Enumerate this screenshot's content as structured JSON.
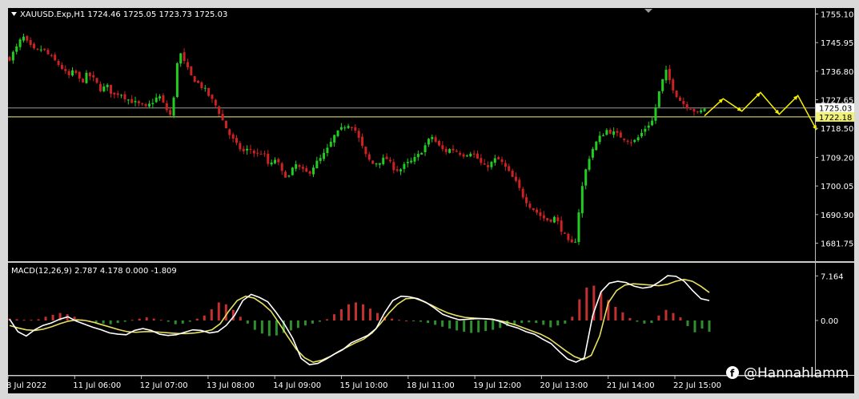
{
  "watermark": "@Hannahlamm",
  "colors": {
    "background": "#000000",
    "bull": "#22cc22",
    "bear": "#cc2222",
    "macd_line": "#ffffff",
    "signal_line": "#e8e060",
    "hist_pos": "#c43030",
    "hist_neg": "#2f8f2f",
    "hline_grey": "#9a9a9a",
    "hline_yellow": "#f2f27a",
    "arrow": "#f7f000"
  },
  "chart_data": [
    {
      "type": "candlestick",
      "header": "XAUUSD.Exp,H1  1724.46 1725.05 1723.73 1725.03",
      "ylim": [
        1677,
        1756
      ],
      "y_ticks": [
        "1755.10",
        "1745.95",
        "1736.80",
        "1727.65",
        "1718.50",
        "1709.20",
        "1700.05",
        "1690.90",
        "1681.75"
      ],
      "price_labels": [
        {
          "text": "1725.03",
          "value": 1725.03,
          "style": "grey"
        },
        {
          "text": "1722.18",
          "value": 1722.18,
          "style": "yellow"
        }
      ],
      "horizontal_lines": [
        {
          "value": 1725.03,
          "style": "grey"
        },
        {
          "value": 1722.18,
          "style": "yellow"
        }
      ],
      "x_ticks": [
        "8 Jul 2022",
        "11 Jul 06:00",
        "12 Jul 07:00",
        "13 Jul 08:00",
        "14 Jul 09:00",
        "15 Jul 10:00",
        "18 Jul 11:00",
        "19 Jul 12:00",
        "20 Jul 13:00",
        "21 Jul 14:00",
        "22 Jul 15:00"
      ],
      "close_path": [
        1741,
        1744,
        1748,
        1745,
        1743,
        1744,
        1742,
        1740,
        1738,
        1735,
        1737,
        1733,
        1736,
        1734,
        1731,
        1732,
        1729,
        1730,
        1728,
        1727,
        1726,
        1725,
        1727,
        1729,
        1725,
        1722,
        1744,
        1739,
        1735,
        1733,
        1731,
        1728,
        1725,
        1720,
        1716,
        1713,
        1711,
        1712,
        1710,
        1711,
        1706,
        1709,
        1704,
        1703,
        1707,
        1705,
        1704,
        1707,
        1709,
        1712,
        1716,
        1718,
        1720,
        1719,
        1714,
        1709,
        1707,
        1708,
        1709,
        1706,
        1705,
        1707,
        1708,
        1710,
        1713,
        1716,
        1713,
        1711,
        1712,
        1711,
        1710,
        1711,
        1709,
        1706,
        1707,
        1709,
        1707,
        1704,
        1701,
        1697,
        1694,
        1692,
        1690,
        1689,
        1690,
        1686,
        1682,
        1681,
        1698,
        1708,
        1713,
        1716,
        1718,
        1717,
        1716,
        1715,
        1714,
        1716,
        1719,
        1721,
        1730,
        1737,
        1732,
        1728,
        1726,
        1725,
        1723,
        1725.03
      ],
      "forecast_path": [
        1722.5,
        1728,
        1724,
        1730,
        1723,
        1729,
        1718
      ]
    },
    {
      "type": "macd",
      "header": "MACD(12,26,9) 2.787 4.178 0.000 -1.809",
      "ylim": [
        -8.5,
        8.5
      ],
      "y_ticks": [
        "7.164",
        "0.00"
      ],
      "macd": [
        0.2,
        -1.8,
        -2.5,
        -1.5,
        -0.8,
        -0.4,
        0.2,
        0.6,
        -0.1,
        -0.6,
        -1.1,
        -1.5,
        -2.0,
        -2.2,
        -2.3,
        -1.6,
        -1.3,
        -1.6,
        -2.2,
        -2.4,
        -2.3,
        -1.9,
        -1.5,
        -1.6,
        -2.0,
        -1.8,
        -0.8,
        0.8,
        3.2,
        4.2,
        3.7,
        3.0,
        1.3,
        -0.6,
        -2.9,
        -6.1,
        -7.1,
        -6.9,
        -6.2,
        -5.4,
        -4.7,
        -3.6,
        -3.0,
        -2.4,
        -1.3,
        1.2,
        3.2,
        3.9,
        3.8,
        3.5,
        2.9,
        2.0,
        1.0,
        0.5,
        0.1,
        0.2,
        0.3,
        0.3,
        0.2,
        -0.2,
        -0.8,
        -1.2,
        -1.8,
        -2.2,
        -3.0,
        -3.7,
        -5.0,
        -6.2,
        -6.7,
        -6.0,
        0.8,
        4.6,
        6.0,
        6.3,
        6.1,
        5.5,
        5.2,
        5.4,
        6.2,
        7.2,
        7.1,
        6.3,
        4.8,
        3.5,
        3.2
      ],
      "signal": [
        -0.8,
        -1.2,
        -1.5,
        -1.6,
        -1.4,
        -1.0,
        -0.5,
        -0.1,
        0.1,
        0.0,
        -0.3,
        -0.7,
        -1.1,
        -1.5,
        -1.8,
        -1.9,
        -1.8,
        -1.8,
        -1.9,
        -2.0,
        -2.1,
        -2.1,
        -2.0,
        -1.8,
        -1.5,
        -0.5,
        1.5,
        3.2,
        3.9,
        3.6,
        2.7,
        1.5,
        -0.5,
        -2.6,
        -4.6,
        -6.0,
        -6.7,
        -6.4,
        -5.8,
        -5.0,
        -4.3,
        -3.6,
        -3.0,
        -2.0,
        -0.5,
        1.2,
        2.6,
        3.5,
        3.6,
        3.1,
        2.5,
        1.8,
        1.2,
        0.8,
        0.5,
        0.4,
        0.3,
        0.2,
        0.0,
        -0.3,
        -0.7,
        -1.2,
        -1.7,
        -2.2,
        -2.9,
        -3.9,
        -4.9,
        -5.8,
        -6.3,
        -5.6,
        -2.5,
        2.8,
        4.8,
        5.7,
        5.9,
        5.8,
        5.7,
        5.6,
        5.8,
        6.3,
        6.6,
        6.3,
        5.5,
        4.5
      ],
      "histogram": [
        0.3,
        0.2,
        0.1,
        0.1,
        0.2,
        0.6,
        0.9,
        1.2,
        1.0,
        0.6,
        0.2,
        0.0,
        -0.3,
        -0.5,
        -0.6,
        -0.4,
        -0.2,
        0.1,
        0.3,
        0.5,
        0.3,
        0.1,
        -0.2,
        -0.6,
        -0.5,
        -0.2,
        0.3,
        0.8,
        1.8,
        2.9,
        2.6,
        1.7,
        0.6,
        -0.5,
        -1.5,
        -2.1,
        -2.5,
        -2.4,
        -2.0,
        -1.6,
        -1.2,
        -0.8,
        -0.5,
        -0.2,
        0.2,
        1.0,
        1.8,
        2.6,
        2.9,
        2.6,
        1.9,
        1.2,
        0.6,
        0.3,
        0.1,
        0.0,
        -0.1,
        -0.2,
        -0.4,
        -0.7,
        -1.0,
        -1.3,
        -1.6,
        -1.8,
        -2.0,
        -1.9,
        -1.7,
        -1.5,
        -1.2,
        -0.9,
        -0.6,
        -0.4,
        -0.3,
        -0.4,
        -0.7,
        -1.1,
        -0.8,
        -0.5,
        0.6,
        3.4,
        5.3,
        5.6,
        4.6,
        3.3,
        2.2,
        1.3,
        0.4,
        -0.2,
        -0.5,
        -0.4,
        0.8,
        1.7,
        1.2,
        0.5,
        -0.9,
        -1.9,
        -1.3,
        -1.8
      ]
    }
  ]
}
